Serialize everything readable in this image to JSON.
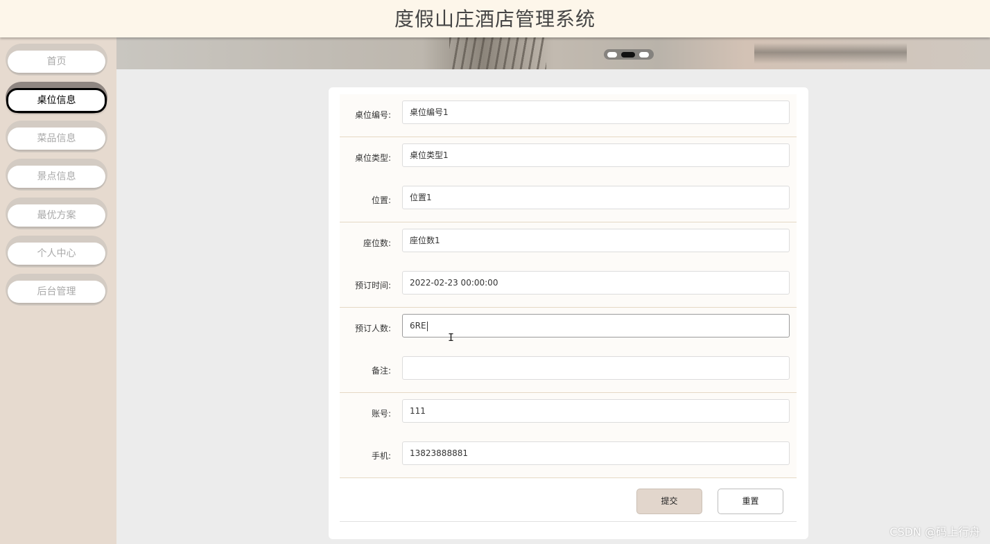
{
  "header": {
    "title": "度假山庄酒店管理系统"
  },
  "sidebar": {
    "items": [
      {
        "label": "首页"
      },
      {
        "label": "桌位信息"
      },
      {
        "label": "菜品信息"
      },
      {
        "label": "景点信息"
      },
      {
        "label": "最优方案"
      },
      {
        "label": "个人中心"
      },
      {
        "label": "后台管理"
      }
    ],
    "active_index": 1
  },
  "banner": {
    "slides": 3,
    "active_slide": 2
  },
  "form": {
    "fields": [
      {
        "label": "桌位编号:",
        "value": "桌位编号1"
      },
      {
        "label": "桌位类型:",
        "value": "桌位类型1"
      },
      {
        "label": "位置:",
        "value": "位置1"
      },
      {
        "label": "座位数:",
        "value": "座位数1"
      },
      {
        "label": "预订时间:",
        "value": "2022-02-23 00:00:00"
      },
      {
        "label": "预订人数:",
        "value": "6RE"
      },
      {
        "label": "备注:",
        "value": ""
      },
      {
        "label": "账号:",
        "value": "111"
      },
      {
        "label": "手机:",
        "value": "13823888881"
      }
    ],
    "submit_label": "提交",
    "reset_label": "重置"
  },
  "watermark": "CSDN @码上行舟",
  "colors": {
    "header_bg": "#fdf6ea",
    "sidebar_bg": "#e6dacf",
    "submit_bg": "#e2d6cc",
    "page_bg": "#ececec"
  },
  "icons": {
    "cursor": "text-cursor-icon"
  }
}
